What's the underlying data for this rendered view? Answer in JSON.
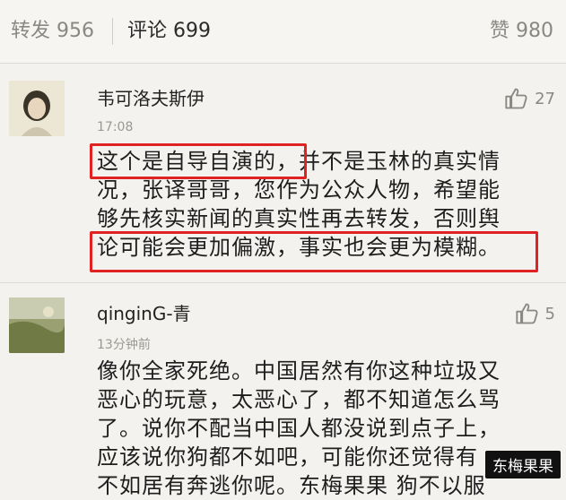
{
  "tabs": {
    "repost": "转发 956",
    "comment": "评论 699",
    "like": "赞 980"
  },
  "comments": [
    {
      "username": "韦可洛夫斯伊",
      "timestamp": "17:08",
      "likes": "27",
      "lines": [
        "这个是自导自演的，并不是玉林的真实情",
        "况，张译哥哥，您作为公众人物，希望能",
        "够先核实新闻的真实性再去转发，否则舆",
        "论可能会更加偏激，事实也会更为模糊。"
      ]
    },
    {
      "username": "qinginG-青",
      "timestamp": "13分钟前",
      "likes": "5",
      "lines": [
        "像你全家死绝。中国居然有你这种垃圾又",
        "恶心的玩意，太恶心了，都不知道怎么骂",
        "了。说你不配当中国人都没说到点子上，",
        "应该说你狗都不如吧，可能你还觉得有",
        "不如居有奔逃你呢。东梅果果 狗不以服"
      ]
    }
  ],
  "watermark": "东梅果果",
  "colors": {
    "highlight": "#e02222",
    "background": "#f3f2ef"
  },
  "icons": {
    "like": "thumbs-up-icon"
  }
}
